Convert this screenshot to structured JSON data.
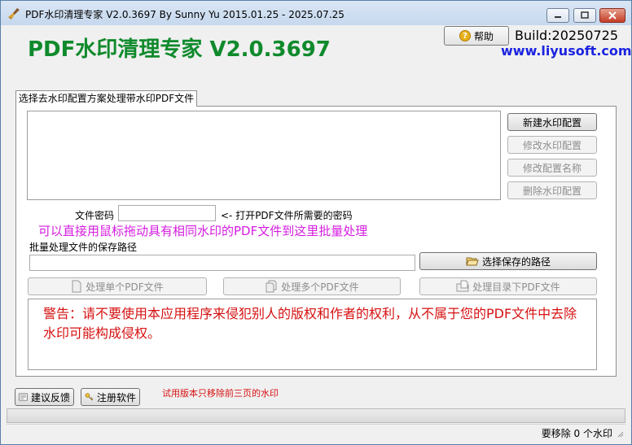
{
  "window": {
    "title": "PDF水印清理专家 V2.0.3697 By Sunny Yu 2015.01.25 - 2025.07.25",
    "controls": [
      "minimize",
      "maximize",
      "close"
    ]
  },
  "header": {
    "app_name": "PDF水印清理专家 V2.0.3697",
    "help_label": "帮助",
    "build": "Build:20250725",
    "website": "www.liyusoft.com"
  },
  "tab": {
    "label": "选择去水印配置方案处理带水印PDF文件"
  },
  "config_buttons": {
    "new": "新建水印配置",
    "edit": "修改水印配置",
    "rename": "修改配置名称",
    "delete": "删除水印配置"
  },
  "password": {
    "label": "文件密码",
    "value": "",
    "hint": "<- 打开PDF文件所需要的密码"
  },
  "drag_hint": "可以直接用鼠标拖动具有相同水印的PDF文件到这里批量处理",
  "save_path": {
    "label": "批量处理文件的保存路径",
    "value": "",
    "choose_button": "选择保存的路径"
  },
  "actions": {
    "single": "处理单个PDF文件",
    "multi": "处理多个PDF文件",
    "directory": "处理目录下PDF文件"
  },
  "warning": "警告：请不要使用本应用程序来侵犯别人的版权和作者的权利，从不属于您的PDF文件中去除水印可能构成侵权。",
  "footer": {
    "feedback": "建议反馈",
    "register": "注册软件",
    "trial_note": "试用版本只移除前三页的水印"
  },
  "status": {
    "text": "要移除 0 个水印"
  },
  "colors": {
    "brand_green": "#0f8a2c",
    "link_blue": "#1b23e0",
    "hint_magenta": "#d41ee0",
    "warning_red": "#d61111"
  }
}
